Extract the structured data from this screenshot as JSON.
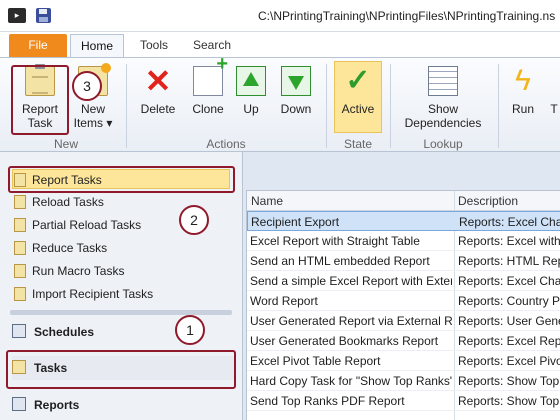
{
  "window": {
    "title": "C:\\NPrintingTraining\\NPrintingFiles\\NPrintingTraining.ns"
  },
  "tabs": [
    {
      "label": "File"
    },
    {
      "label": "Home"
    },
    {
      "label": "Tools"
    },
    {
      "label": "Search"
    }
  ],
  "ribbon": {
    "report_task_line1": "Report",
    "report_task_line2": "Task",
    "new_items_line1": "New",
    "new_items_line2": "Items ▾",
    "group_new": "New",
    "delete": "Delete",
    "clone": "Clone",
    "up": "Up",
    "down": "Down",
    "group_actions": "Actions",
    "active": "Active",
    "group_state": "State",
    "show_dep_line1": "Show",
    "show_dep_line2": "Dependencies",
    "group_lookup": "Lookup",
    "run": "Run",
    "cut_label": "T"
  },
  "sidebar": {
    "items": [
      {
        "label": "Report Tasks"
      },
      {
        "label": "Reload Tasks"
      },
      {
        "label": "Partial Reload Tasks"
      },
      {
        "label": "Reduce Tasks"
      },
      {
        "label": "Run Macro Tasks"
      },
      {
        "label": "Import Recipient Tasks"
      }
    ],
    "sections": [
      {
        "label": "Schedules"
      },
      {
        "label": "Tasks"
      },
      {
        "label": "Reports"
      }
    ]
  },
  "grid": {
    "headers": {
      "name": "Name",
      "description": "Description"
    },
    "rows": [
      {
        "name": "Recipient Export",
        "desc": "Reports: Excel Chart"
      },
      {
        "name": "Excel Report with Straight Table",
        "desc": "Reports: Excel with St"
      },
      {
        "name": "Send an HTML embedded Report",
        "desc": "Reports: HTML Rep"
      },
      {
        "name": "Send a simple Excel Report with External",
        "desc": "Reports: Excel Chart"
      },
      {
        "name": "Word Report",
        "desc": "Reports: Country Pa"
      },
      {
        "name": "User Generated Report via External Req",
        "desc": "Reports: User Gener"
      },
      {
        "name": "User Generated Bookmarks Report",
        "desc": "Reports: Excel Repo"
      },
      {
        "name": "Excel Pivot Table Report",
        "desc": "Reports: Excel Pivot"
      },
      {
        "name": "Hard Copy Task for \"Show Top Ranks\"",
        "desc": "Reports: Show Top"
      },
      {
        "name": "Send Top Ranks PDF Report",
        "desc": "Reports: Show Top"
      }
    ]
  },
  "callouts": {
    "one": "1",
    "two": "2",
    "three": "3"
  }
}
